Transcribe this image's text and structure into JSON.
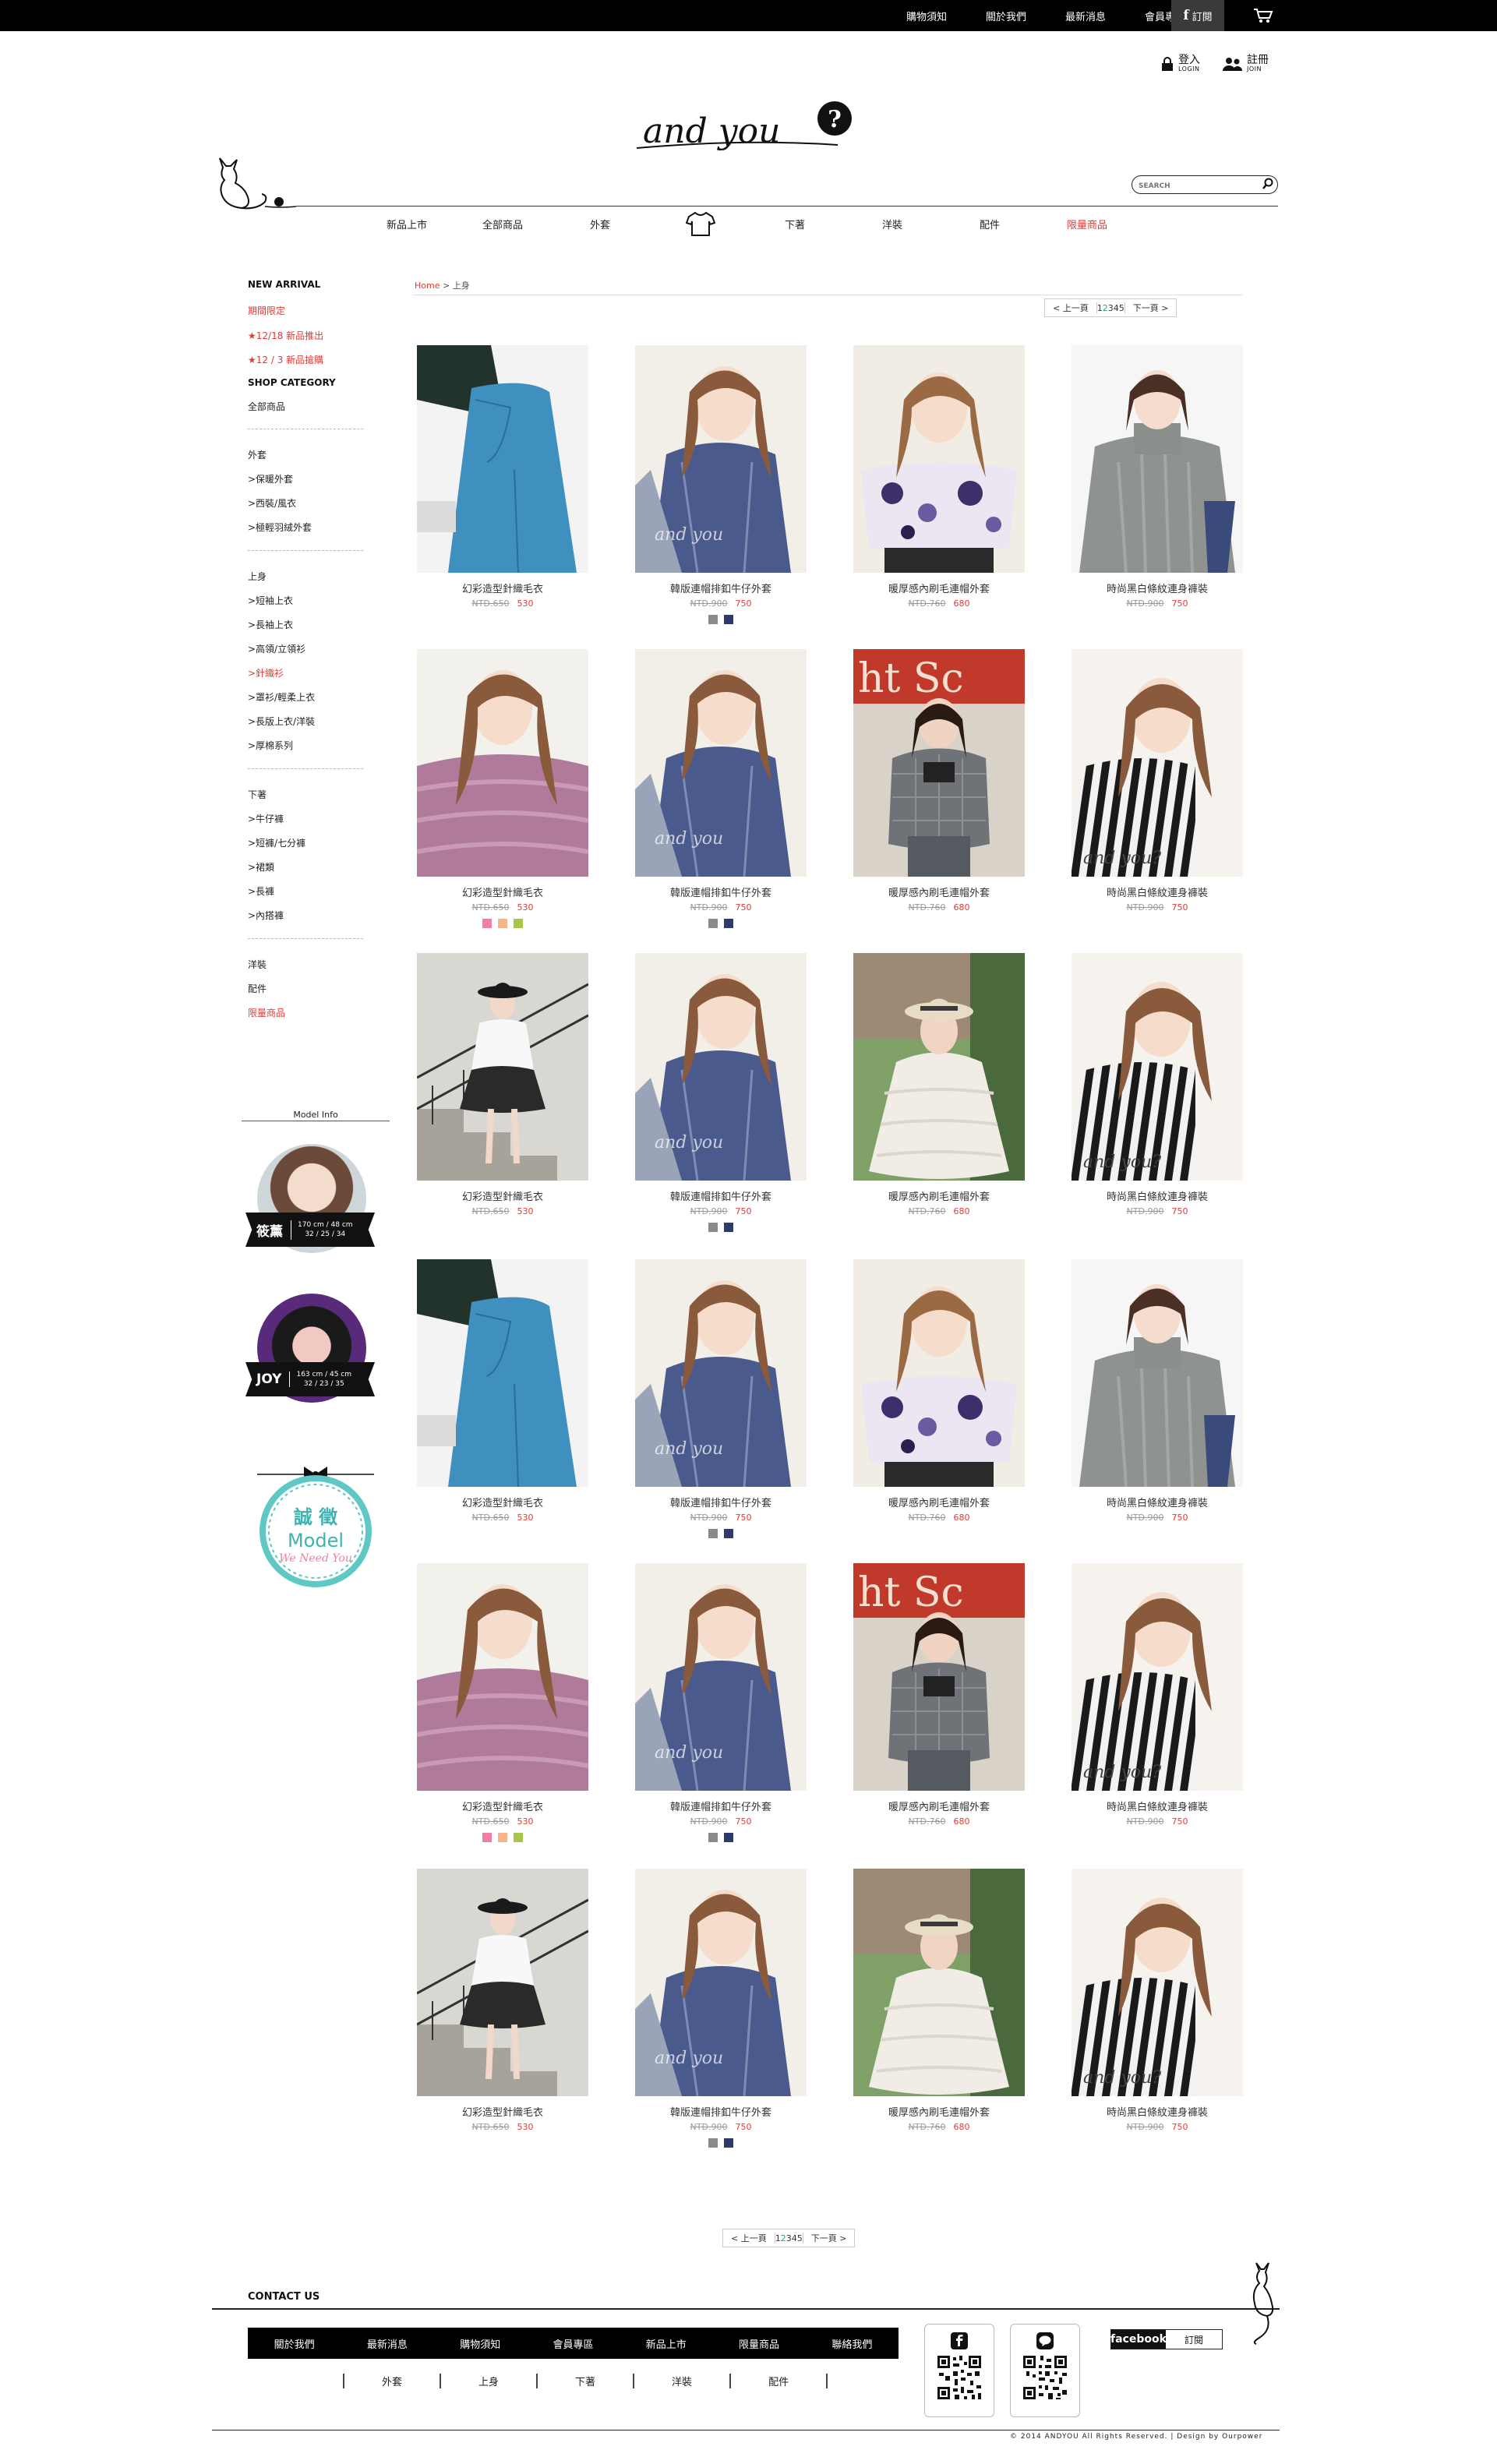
{
  "topnav": {
    "items": [
      "購物須知",
      "關於我們",
      "最新消息",
      "會員專區"
    ],
    "subscribe": "訂閱",
    "facebook_letter": "f"
  },
  "header": {
    "login": "登入",
    "login_sub": "LOGIN",
    "join": "註冊",
    "join_sub": "JOIN",
    "logo_text": "and you",
    "search_placeholder": "SEARCH"
  },
  "mainnav": {
    "items": [
      "新品上市",
      "全部商品",
      "外套",
      "下著",
      "洋裝",
      "配件",
      "限量商品"
    ]
  },
  "sidebar": {
    "new_arrival": "NEW ARRIVAL",
    "limited": "期間限定",
    "new1": "★12/18 新品推出",
    "new2": "★12 / 3 新品搶購",
    "shop_category": "SHOP CATEGORY",
    "all": "全部商品",
    "coat": "外套",
    "coat_items": [
      ">保暖外套",
      ">西裝/風衣",
      ">極輕羽絨外套"
    ],
    "tops": "上身",
    "tops_items": [
      ">短袖上衣",
      ">長袖上衣",
      ">高領/立領衫",
      ">針織衫",
      ">罩衫/輕柔上衣",
      ">長版上衣/洋裝",
      ">厚棉系列"
    ],
    "bottoms": "下著",
    "bottoms_items": [
      ">牛仔褲",
      ">短褲/七分褲",
      ">裙類",
      ">長褲",
      ">內搭褲"
    ],
    "dress": "洋裝",
    "accessories": "配件",
    "limited_items": "限量商品",
    "model_info": "Model Info",
    "models": [
      {
        "name": "筱薰",
        "stats1": "170 cm / 48 cm",
        "stats2": "32 / 25 / 34"
      },
      {
        "name": "JOY",
        "stats1": "163 cm / 45 cm",
        "stats2": "32 / 23 / 35"
      }
    ],
    "recruit_top": "誠 徵",
    "recruit_mid": "Model",
    "recruit_bot": "We Need You"
  },
  "content": {
    "breadcrumb_home": "Home",
    "breadcrumb_rest": " > 上身",
    "pager": {
      "prev": "< 上一頁",
      "pages": [
        "1",
        "2",
        "3",
        "4",
        "5"
      ],
      "current": "2",
      "next": "下一頁 >"
    }
  },
  "colors": {
    "accent_red": "#e53935",
    "pager_current": "#2a9d8f",
    "swatch_gray": "#8a8a8a",
    "swatch_navy": "#2e3a6b",
    "swatch_pink": "#f07fa5",
    "swatch_peach": "#f5b48a",
    "swatch_lime": "#a8c74a"
  },
  "product_types": {
    "sweater": {
      "name": "幻彩造型針織毛衣",
      "old": "NTD.650",
      "price": "530"
    },
    "denim": {
      "name": "韓版連帽排釦牛仔外套",
      "old": "NTD.900",
      "price": "750"
    },
    "warm": {
      "name": "暖厚感內刷毛連帽外套",
      "old": "NTD.760",
      "price": "680"
    },
    "stripe": {
      "name": "時尚黑白條紋連身褲裝",
      "old": "NTD.900",
      "price": "750"
    }
  },
  "products": [
    {
      "type": "sweater",
      "img": "jeans-icon",
      "swatches": []
    },
    {
      "type": "denim",
      "img": "denim-jacket-icon",
      "swatches": [
        "gray",
        "navy"
      ]
    },
    {
      "type": "warm",
      "img": "floral-top-icon",
      "swatches": []
    },
    {
      "type": "stripe",
      "img": "gray-sweater-icon",
      "swatches": []
    },
    {
      "type": "sweater",
      "img": "pink-knit-icon",
      "swatches": [
        "pink",
        "peach",
        "lime"
      ]
    },
    {
      "type": "denim",
      "img": "denim-jacket-icon",
      "swatches": [
        "gray",
        "navy"
      ]
    },
    {
      "type": "warm",
      "img": "plaid-jacket-icon",
      "swatches": []
    },
    {
      "type": "stripe",
      "img": "stripe-jumpsuit-icon",
      "swatches": []
    },
    {
      "type": "sweater",
      "img": "stairs-model-icon",
      "swatches": []
    },
    {
      "type": "denim",
      "img": "denim-jacket-icon",
      "swatches": [
        "gray",
        "navy"
      ]
    },
    {
      "type": "warm",
      "img": "white-knit-icon",
      "swatches": []
    },
    {
      "type": "stripe",
      "img": "stripe-jumpsuit-icon",
      "swatches": []
    },
    {
      "type": "sweater",
      "img": "jeans-icon",
      "swatches": []
    },
    {
      "type": "denim",
      "img": "denim-jacket-icon",
      "swatches": [
        "gray",
        "navy"
      ]
    },
    {
      "type": "warm",
      "img": "floral-top-icon",
      "swatches": []
    },
    {
      "type": "stripe",
      "img": "gray-sweater-icon",
      "swatches": []
    },
    {
      "type": "sweater",
      "img": "pink-knit-icon",
      "swatches": [
        "pink",
        "peach",
        "lime"
      ]
    },
    {
      "type": "denim",
      "img": "denim-jacket-icon",
      "swatches": [
        "gray",
        "navy"
      ]
    },
    {
      "type": "warm",
      "img": "plaid-jacket-icon",
      "swatches": []
    },
    {
      "type": "stripe",
      "img": "stripe-jumpsuit-icon",
      "swatches": []
    },
    {
      "type": "sweater",
      "img": "stairs-model-icon",
      "swatches": []
    },
    {
      "type": "denim",
      "img": "denim-jacket-icon",
      "swatches": [
        "gray",
        "navy"
      ]
    },
    {
      "type": "warm",
      "img": "white-knit-icon",
      "swatches": []
    },
    {
      "type": "stripe",
      "img": "stripe-jumpsuit-icon",
      "swatches": []
    }
  ],
  "footer": {
    "contact": "CONTACT US",
    "bar_items": [
      "關於我們",
      "最新消息",
      "購物須知",
      "會員專區",
      "新品上市",
      "限量商品",
      "聯絡我們"
    ],
    "cats": [
      "外套",
      "上身",
      "下著",
      "洋裝",
      "配件"
    ],
    "facebook": "facebook",
    "subscribe": "訂閱",
    "copyright": "© 2014 ANDYOU All Rights Reserved. | Design by Ourpower"
  }
}
